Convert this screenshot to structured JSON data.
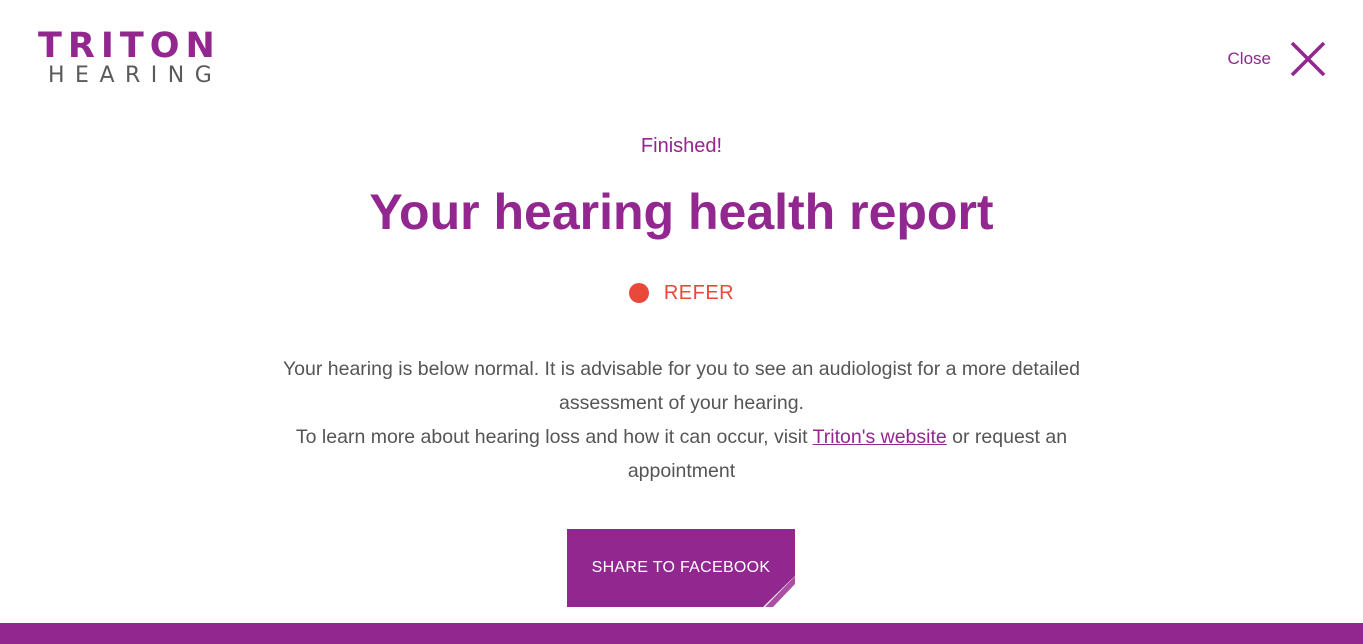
{
  "brand": {
    "logo_top": "TRITON",
    "logo_bottom": "HEARING",
    "primary_color": "#92278f",
    "secondary_color": "#5a5a5a"
  },
  "header": {
    "close_label": "Close",
    "close_icon": "close-icon"
  },
  "report": {
    "eyebrow": "Finished!",
    "title": "Your hearing health report",
    "status": {
      "label": "REFER",
      "color": "#e8493a"
    },
    "paragraph_1": "Your hearing is below normal. It is advisable for you to see an audiologist for a more detailed assessment of your hearing.",
    "paragraph_2_before_link": "To learn more about hearing loss and how it can occur, visit ",
    "paragraph_2_link": "Triton's website",
    "paragraph_2_after_link": " or request an appointment"
  },
  "actions": {
    "share_label": "SHARE TO FACEBOOK"
  }
}
